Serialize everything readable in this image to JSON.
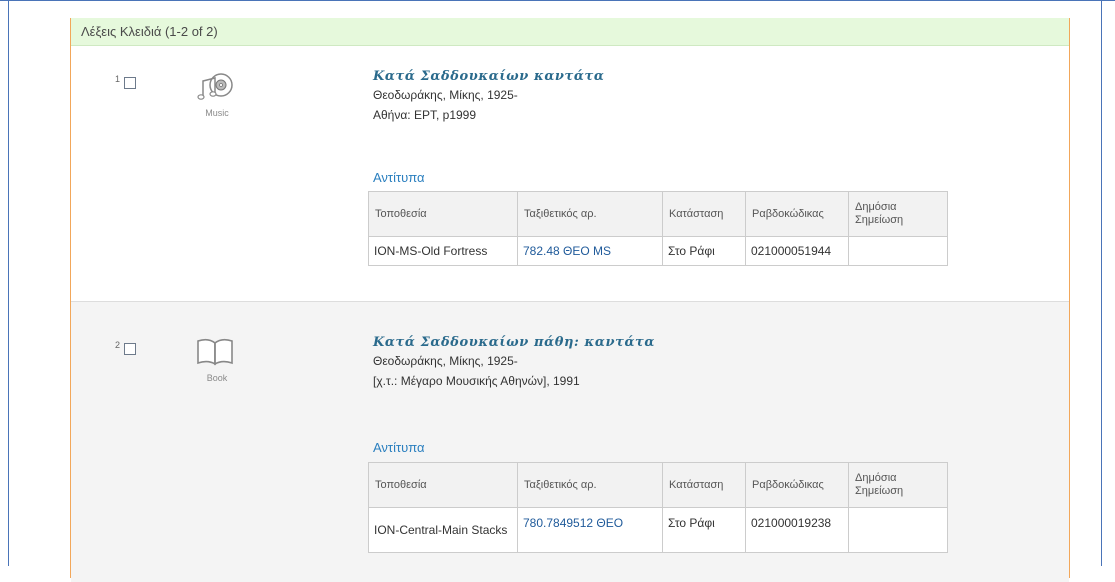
{
  "results_header": "Λέξεις Κλειδιά (1-2 of 2)",
  "holdings_columns": [
    "Τοποθεσία",
    "Ταξιθετικός αρ.",
    "Κατάσταση",
    "Ραβδοκώδικας",
    "Δημόσια Σημείωση"
  ],
  "records": [
    {
      "number": "1",
      "format_icon": "music-cd-icon",
      "format_label": "Music",
      "title": "Κατά Σαδδουκαίων καντάτα",
      "author": "Θεοδωράκης, Μίκης, 1925-",
      "publication": "Αθήνα: ΕΡΤ, p1999",
      "holdings_label": "Αντίτυπα",
      "holdings": [
        {
          "location": "ION-MS-Old Fortress",
          "call_number": "782.48 ΘΕΟ MS",
          "status": "Στο Ράφι",
          "barcode": "021000051944",
          "public_note": ""
        }
      ]
    },
    {
      "number": "2",
      "format_icon": "open-book-icon",
      "format_label": "Book",
      "title": "Κατά Σαδδουκαίων πάθη: καντάτα",
      "author": "Θεοδωράκης, Μίκης, 1925-",
      "publication": "[χ.τ.: Μέγαρο Μουσικής Αθηνών], 1991",
      "holdings_label": "Αντίτυπα",
      "holdings": [
        {
          "location": "ION-Central-Main Stacks",
          "call_number": "780.7849512 ΘΕΟ",
          "status": "Στο Ράφι",
          "barcode": "021000019238",
          "public_note": ""
        }
      ]
    }
  ],
  "colors": {
    "header_bg": "#e6f9dc",
    "panel_border": "#f2a75a",
    "link": "#2a7fbf",
    "title": "#2a6a8c"
  }
}
